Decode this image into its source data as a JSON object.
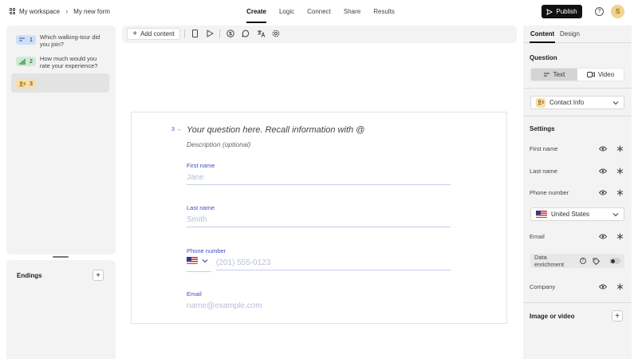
{
  "header": {
    "workspace": "My workspace",
    "form_name": "My new form",
    "tabs": [
      "Create",
      "Logic",
      "Connect",
      "Share",
      "Results"
    ],
    "active_tab": "Create",
    "publish_label": "Publish",
    "help_glyph": "?",
    "avatar_initial": "S"
  },
  "questions": [
    {
      "num": "1",
      "text": "Which walking-tour did you join?",
      "color": "#cfe0f7",
      "icon": "short-text-icon"
    },
    {
      "num": "2",
      "text": "How much would you rate your experience?",
      "color": "#cdebd3",
      "icon": "rating-icon"
    },
    {
      "num": "3",
      "text": "",
      "color": "#f7dfa8",
      "icon": "contact-info-icon",
      "selected": true
    }
  ],
  "endings": {
    "title": "Endings",
    "add_glyph": "+"
  },
  "toolbar": {
    "add_content_label": "Add content"
  },
  "question": {
    "number": "3",
    "title_placeholder": "Your question here. Recall information with @",
    "description_placeholder": "Description (optional)",
    "fields": [
      {
        "label": "First name",
        "placeholder": "Jane"
      },
      {
        "label": "Last name",
        "placeholder": "Smith"
      },
      {
        "label": "Phone number",
        "placeholder": "(201) 555-0123"
      },
      {
        "label": "Email",
        "placeholder": "name@example.com"
      }
    ]
  },
  "right_panel": {
    "tabs": [
      "Content",
      "Design"
    ],
    "active_tab": "Content",
    "question_heading": "Question",
    "text_label": "Text",
    "video_label": "Video",
    "type_dropdown": "Contact Info",
    "settings_heading": "Settings",
    "settings": [
      "First name",
      "Last name",
      "Phone number",
      "Email",
      "Company"
    ],
    "country_dropdown": "United States",
    "data_enrichment_label": "Data enrichment",
    "image_video_label": "Image or video",
    "add_glyph": "+"
  }
}
